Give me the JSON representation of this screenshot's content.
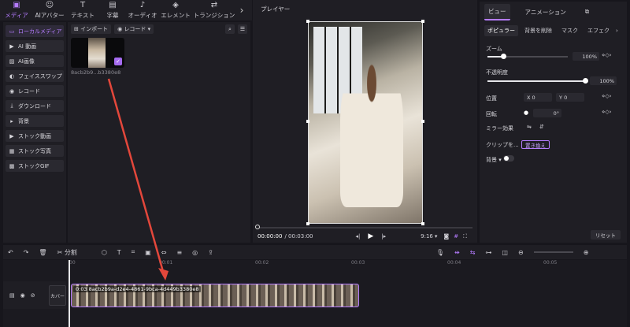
{
  "top_tabs": [
    {
      "label": "メディア",
      "icon": "media-icon",
      "active": true
    },
    {
      "label": "AIアバター",
      "icon": "avatar-icon",
      "active": false
    },
    {
      "label": "テキスト",
      "icon": "text-icon",
      "active": false
    },
    {
      "label": "字幕",
      "icon": "caption-icon",
      "active": false
    },
    {
      "label": "オーディオ",
      "icon": "audio-icon",
      "active": false
    },
    {
      "label": "エレメント",
      "icon": "element-icon",
      "active": false
    },
    {
      "label": "トランジション",
      "icon": "transition-icon",
      "active": false
    }
  ],
  "sidebar": {
    "items": [
      {
        "label": "ローカルメディア",
        "icon": "folder-icon"
      },
      {
        "label": "AI 動画",
        "icon": "ai-video-icon"
      },
      {
        "label": "AI画像",
        "icon": "ai-image-icon"
      },
      {
        "label": "フェイススワップ",
        "icon": "face-swap-icon"
      },
      {
        "label": "レコード",
        "icon": "record-icon"
      },
      {
        "label": "ダウンロード",
        "icon": "download-icon"
      },
      {
        "label": "背景",
        "icon": "background-icon"
      },
      {
        "label": "ストック動画",
        "icon": "stock-video-icon"
      },
      {
        "label": "ストック写真",
        "icon": "stock-photo-icon"
      },
      {
        "label": "ストックGIF",
        "icon": "stock-gif-icon"
      }
    ]
  },
  "media": {
    "import_label": "インポート",
    "record_label": "レコード",
    "file_name": "8acb2b9...b3380e8"
  },
  "player": {
    "title": "プレイヤー",
    "time_current": "00:00:00",
    "time_total": "/ 00:03:00",
    "aspect": "9:16"
  },
  "right_panel": {
    "tabs": [
      "ビュー",
      "アニメーション"
    ],
    "subtabs": [
      "ポピュラー",
      "背景を削除",
      "マスク",
      "エフェク"
    ],
    "zoom_label": "ズーム",
    "zoom_value": "100%",
    "opacity_label": "不透明度",
    "opacity_value": "100%",
    "position_label": "位置",
    "pos_x_label": "X",
    "pos_x": "0",
    "pos_y_label": "Y",
    "pos_y": "0",
    "rotate_label": "回転",
    "rotate_value": "0°",
    "mirror_label": "ミラー効果",
    "clip_label": "クリップを...",
    "replace_label": "置き換え",
    "background_label": "背景",
    "reset_label": "リセット"
  },
  "timeline": {
    "split_label": "分割",
    "ruler": [
      "00",
      "00:01",
      "00:02",
      "00:03",
      "00:04",
      "00:05"
    ],
    "cover_label": "カバー",
    "clip_label": "0:03 8acb2b9a-d2e4-4861-9bca-4d449b3380e8"
  },
  "colors": {
    "accent": "#b57cff",
    "annotation_arrow": "#e3473b"
  }
}
